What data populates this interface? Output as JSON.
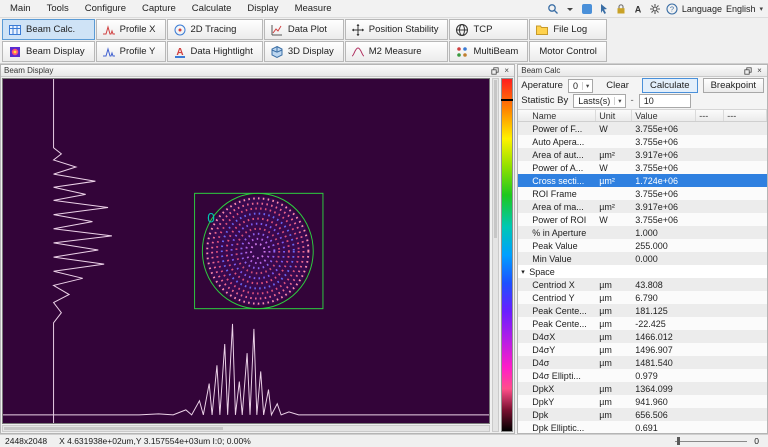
{
  "colors": {
    "beam_background": "#330439",
    "overlay_green": "#2ecc40",
    "beam_label_teal": "#00c8b4",
    "selected_row_blue": "#2f80e0",
    "toolbar_selected_blue": "#cfe3f6",
    "ring_palette": [
      "#ff8fae",
      "#f06b92",
      "#e0527c",
      "#6a66f2",
      "#e0527c",
      "#7d5cf0",
      "#cf4d78",
      "#8f62ee",
      "#b665e6",
      "#cf7ae8"
    ]
  },
  "menu_bar": {
    "items": [
      "Main",
      "Tools",
      "Configure",
      "Capture",
      "Calculate",
      "Display",
      "Measure"
    ],
    "right": {
      "icons": [
        "search-icon",
        "dropdown-arrow-icon",
        "swatch-icon",
        "pointer-icon",
        "lock-icon",
        "font-icon",
        "gear-icon",
        "help-icon"
      ],
      "language_label": "Language",
      "language_value": "English"
    }
  },
  "toolbar": {
    "rows": [
      [
        {
          "label": "Beam Calc.",
          "icon": "beam-calc-icon",
          "selected": true
        },
        {
          "label": "Profile X",
          "icon": "profile-x-icon"
        },
        {
          "label": "2D Tracing",
          "icon": "tracing-2d-icon"
        },
        {
          "label": "Data Plot",
          "icon": "data-plot-icon"
        },
        {
          "label": "Position Stability",
          "icon": "position-stability-icon"
        },
        {
          "label": "TCP",
          "icon": "tcp-icon"
        },
        {
          "label": "File Log",
          "icon": "file-log-icon"
        }
      ],
      [
        {
          "label": "Beam Display",
          "icon": "beam-display-icon"
        },
        {
          "label": "Profile Y",
          "icon": "profile-y-icon"
        },
        {
          "label": "Data Hightlight",
          "icon": "data-highlight-icon"
        },
        {
          "label": "3D Display",
          "icon": "display-3d-icon"
        },
        {
          "label": "M2 Measure",
          "icon": "m2-measure-icon"
        },
        {
          "label": "MultiBeam",
          "icon": "multibeam-icon"
        },
        {
          "label": "Motor Control",
          "icon": null
        }
      ]
    ]
  },
  "beam_display": {
    "title": "Beam Display",
    "beam_index_label": "0"
  },
  "beam_calc": {
    "title": "Beam Calc",
    "controls": {
      "aperture_label": "Aperature",
      "aperture_value": "0",
      "clear_label": "Clear",
      "calculate_label": "Calculate",
      "breakpoint_label": "Breakpoint",
      "statistic_label": "Statistic By",
      "statistic_mode": "Lasts(s)",
      "statistic_separator": "-",
      "statistic_value": "10"
    },
    "table": {
      "columns": [
        "Name",
        "Unit",
        "Value",
        "---",
        "---"
      ],
      "rows": [
        {
          "name": "Power of F...",
          "unit": "W",
          "value": "3.755e+06"
        },
        {
          "name": "Auto Apera...",
          "unit": "",
          "value": "3.755e+06"
        },
        {
          "name": "Area of aut...",
          "unit": "µm²",
          "value": "3.917e+06"
        },
        {
          "name": "Power of A...",
          "unit": "W",
          "value": "3.755e+06"
        },
        {
          "name": "Cross secti...",
          "unit": "µm²",
          "value": "1.724e+06",
          "selected": true
        },
        {
          "name": "ROI Frame",
          "unit": "",
          "value": "3.755e+06"
        },
        {
          "name": "Area of ma...",
          "unit": "µm²",
          "value": "3.917e+06"
        },
        {
          "name": "Power of ROI",
          "unit": "W",
          "value": "3.755e+06"
        },
        {
          "name": "% in Aperture",
          "unit": "",
          "value": "1.000"
        },
        {
          "name": "Peak Value",
          "unit": "",
          "value": "255.000"
        },
        {
          "name": "Min Value",
          "unit": "",
          "value": "0.000"
        },
        {
          "name": "Space",
          "group": true
        },
        {
          "name": "Centriod X",
          "unit": "µm",
          "value": "43.808"
        },
        {
          "name": "Centriod Y",
          "unit": "µm",
          "value": "6.790"
        },
        {
          "name": "Peak Cente...",
          "unit": "µm",
          "value": "181.125"
        },
        {
          "name": "Peak Cente...",
          "unit": "µm",
          "value": "-22.425"
        },
        {
          "name": "D4σX",
          "unit": "µm",
          "value": "1466.012"
        },
        {
          "name": "D4σY",
          "unit": "µm",
          "value": "1496.907"
        },
        {
          "name": "D4σ",
          "unit": "µm",
          "value": "1481.540"
        },
        {
          "name": "D4σ Ellipti...",
          "unit": "",
          "value": "0.979"
        },
        {
          "name": "DpkX",
          "unit": "µm",
          "value": "1364.099"
        },
        {
          "name": "DpkY",
          "unit": "µm",
          "value": "941.960"
        },
        {
          "name": "Dpk",
          "unit": "µm",
          "value": "656.506"
        },
        {
          "name": "Dpk Elliptic...",
          "unit": "",
          "value": "0.691"
        }
      ]
    }
  },
  "status_bar": {
    "resolution": "2448x2048",
    "cursor_info": "X 4.631938e+02um,Y 3.157554e+03um I:0; 0.00%",
    "slider_value": "0"
  }
}
